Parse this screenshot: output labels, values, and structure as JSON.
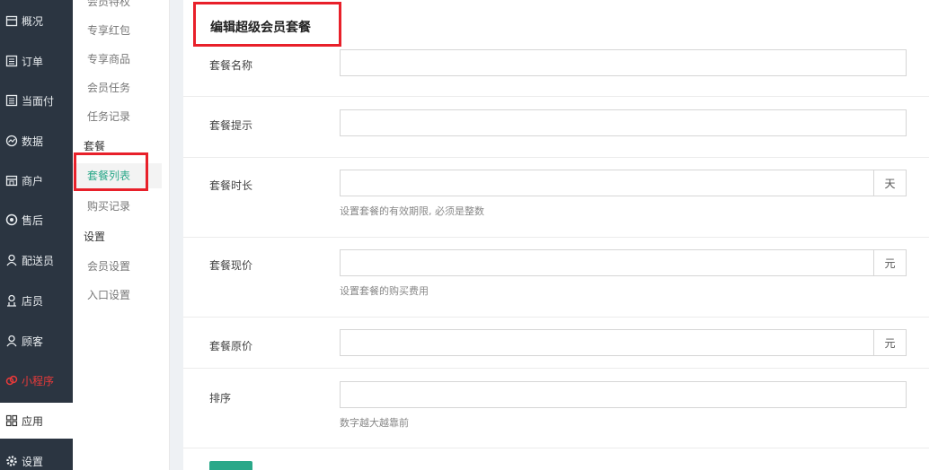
{
  "nav": {
    "items": [
      {
        "label": "概况",
        "icon": "calendar-icon"
      },
      {
        "label": "订单",
        "icon": "list-icon"
      },
      {
        "label": "当面付",
        "icon": "list-icon"
      },
      {
        "label": "数据",
        "icon": "chart-icon"
      },
      {
        "label": "商户",
        "icon": "shop-icon"
      },
      {
        "label": "售后",
        "icon": "service-icon"
      },
      {
        "label": "配送员",
        "icon": "user-icon"
      },
      {
        "label": "店员",
        "icon": "user-icon"
      },
      {
        "label": "顾客",
        "icon": "user-icon"
      },
      {
        "label": "小程序",
        "icon": "miniapp-icon"
      },
      {
        "label": "应用",
        "icon": "apps-icon"
      },
      {
        "label": "设置",
        "icon": "gear-icon"
      }
    ]
  },
  "submenu": {
    "cut_top": "会员特权",
    "items_a": [
      "专享红包",
      "专享商品",
      "会员任务",
      "任务记录"
    ],
    "group_package": "套餐",
    "items_b": [
      "套餐列表",
      "购买记录"
    ],
    "group_settings": "设置",
    "items_c": [
      "会员设置",
      "入口设置"
    ]
  },
  "form": {
    "title": "编辑超级会员套餐",
    "name_label": "套餐名称",
    "name_value": "",
    "tip_label": "套餐提示",
    "tip_value": "",
    "duration_label": "套餐时长",
    "duration_value": "",
    "duration_unit": "天",
    "duration_help": "设置套餐的有效期限, 必须是整数",
    "price_label": "套餐现价",
    "price_value": "",
    "price_unit": "元",
    "price_help": "设置套餐的购买费用",
    "orig_label": "套餐原价",
    "orig_value": "",
    "orig_unit": "元",
    "sort_label": "排序",
    "sort_value": "",
    "sort_help": "数字越大越靠前"
  },
  "colors": {
    "nav_bg": "#2b3541",
    "accent": "#2aa889",
    "highlight": "#e8202a"
  }
}
